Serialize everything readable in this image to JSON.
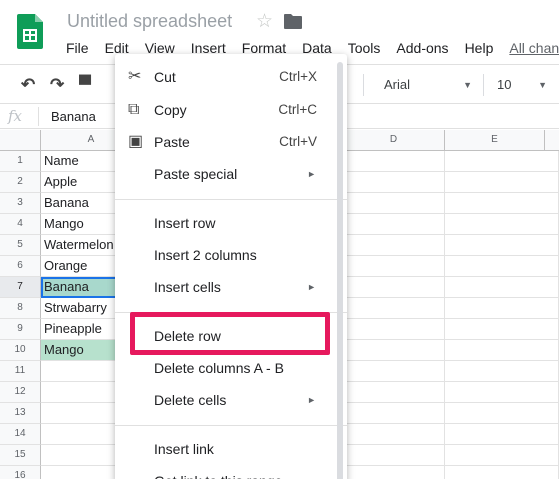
{
  "app": {
    "title": "Untitled spreadsheet",
    "brand_color": "#0f9d58"
  },
  "menubar": {
    "items": [
      "File",
      "Edit",
      "View",
      "Insert",
      "Format",
      "Data",
      "Tools",
      "Add-ons",
      "Help"
    ],
    "last_edit_link": "All chan"
  },
  "toolbar": {
    "font": "Arial",
    "font_size": "10"
  },
  "formula_bar": {
    "fx_label": "fx",
    "value": "Banana"
  },
  "columns": [
    "A",
    "D",
    "E"
  ],
  "rows": [
    "1",
    "2",
    "3",
    "4",
    "5",
    "6",
    "7",
    "8",
    "9",
    "10",
    "11",
    "12",
    "13",
    "14",
    "15",
    "16"
  ],
  "column_a": [
    "Name",
    "Apple",
    "Banana",
    "Mango",
    "Watermelon",
    "Orange",
    "Banana",
    "Strwabarry",
    "Pineapple",
    "Mango",
    "",
    "",
    "",
    "",
    "",
    ""
  ],
  "selection": {
    "active_row": "7",
    "highlighted_rows": [
      "7",
      "10"
    ],
    "active_color": "#a8d8cc",
    "highlight_color": "#b7e1cd"
  },
  "context_menu": {
    "cut": {
      "label": "Cut",
      "shortcut": "Ctrl+X",
      "icon": "scissors-icon"
    },
    "copy": {
      "label": "Copy",
      "shortcut": "Ctrl+C",
      "icon": "copy-icon"
    },
    "paste": {
      "label": "Paste",
      "shortcut": "Ctrl+V",
      "icon": "clipboard-icon"
    },
    "paste_special": {
      "label": "Paste special"
    },
    "insert_row": {
      "label": "Insert row"
    },
    "insert_columns": {
      "label": "Insert 2 columns"
    },
    "insert_cells": {
      "label": "Insert cells"
    },
    "delete_row": {
      "label": "Delete row"
    },
    "delete_columns": {
      "label": "Delete columns A - B"
    },
    "delete_cells": {
      "label": "Delete cells"
    },
    "insert_link": {
      "label": "Insert link"
    },
    "get_link": {
      "label": "Get link to this range"
    },
    "annotation_color": "#e6195d"
  }
}
